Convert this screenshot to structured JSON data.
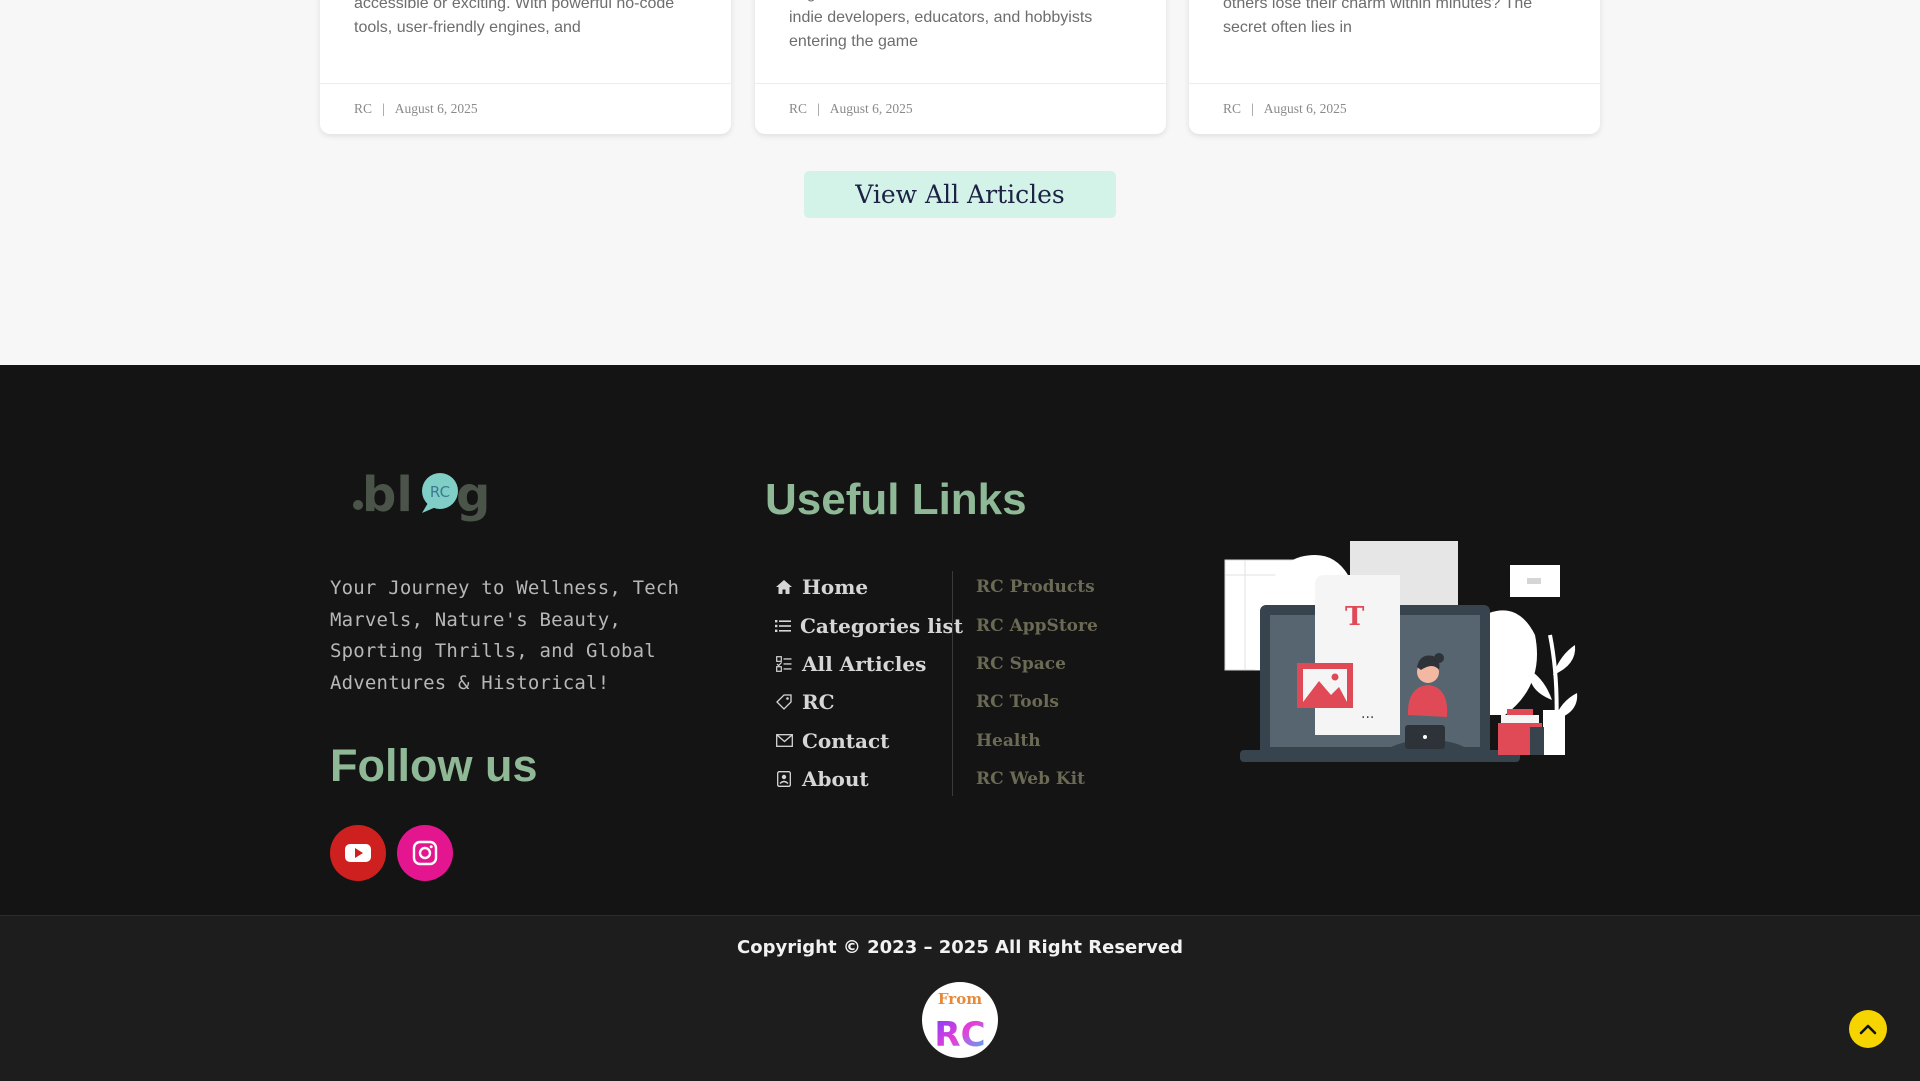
{
  "articles": [
    {
      "excerpt": "accessible or exciting. With powerful no-code tools, user-friendly engines, and",
      "author": "RC",
      "separator": "|",
      "date": "August 6, 2025"
    },
    {
      "excerpt": "engine is more critical than ever. With the rise of indie developers, educators, and hobbyists entering the game",
      "author": "RC",
      "separator": "|",
      "date": "August 6, 2025"
    },
    {
      "excerpt": "others lose their charm within minutes? The secret often lies in",
      "author": "RC",
      "separator": "|",
      "date": "August 6, 2025"
    }
  ],
  "view_all_label": "View All Articles",
  "footer": {
    "logo_text": ".blog",
    "logo_badge": "RC",
    "tagline": "Your Journey to Wellness, Tech Marvels, Nature's Beauty, Sporting Thrills, and Global Adventures & Historical!",
    "follow_heading": "Follow us",
    "useful_heading": "Useful Links",
    "main_links": [
      {
        "label": "Home",
        "icon": "home-icon"
      },
      {
        "label": "Categories list",
        "icon": "list-icon"
      },
      {
        "label": "All Articles",
        "icon": "checklist-icon"
      },
      {
        "label": "RC",
        "icon": "tag-icon"
      },
      {
        "label": "Contact",
        "icon": "envelope-icon"
      },
      {
        "label": "About",
        "icon": "contact-card-icon"
      }
    ],
    "rc_links": [
      {
        "label": "RC Products"
      },
      {
        "label": "RC AppStore"
      },
      {
        "label": "RC Space"
      },
      {
        "label": "RC Tools"
      },
      {
        "label": "Health"
      },
      {
        "label": "RC Web Kit"
      }
    ],
    "copyright": "Copyright © 2023 – 2025 All Right Reserved",
    "from_text": "From",
    "from_logo": "RC"
  },
  "colors": {
    "accent_green": "#8fb996",
    "button_bg": "#d3f2e8",
    "youtube": "#cd201f",
    "instagram": "#e4168f",
    "scroll_top": "#f5d400"
  }
}
